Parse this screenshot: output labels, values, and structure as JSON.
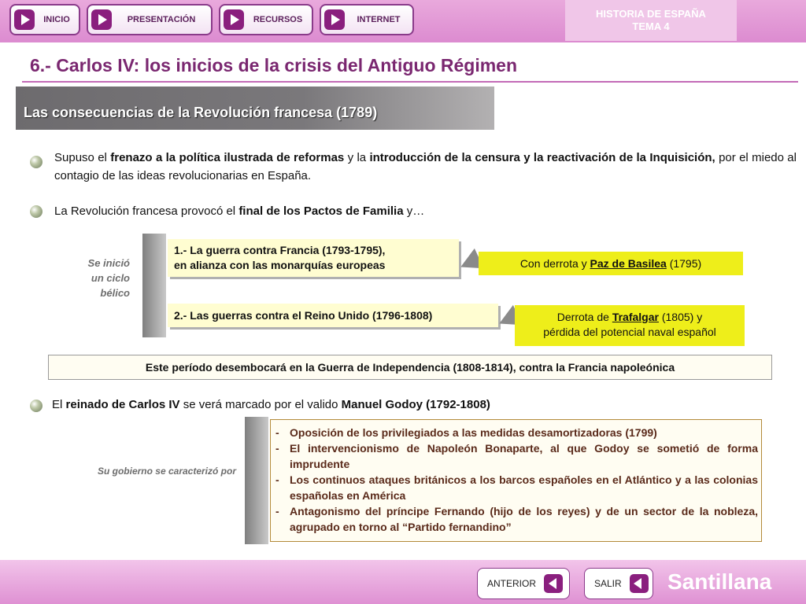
{
  "nav": {
    "inicio": "INICIO",
    "presentacion": "PRESENTACIÓN",
    "recursos": "RECURSOS",
    "internet": "INTERNET"
  },
  "topic": {
    "line1": "HISTORIA DE ESPAÑA",
    "line2": "TEMA 4"
  },
  "page_title": "6.- Carlos IV: los inicios de la crisis del Antiguo Régimen",
  "section_title": "Las consecuencias de la Revolución francesa (1789)",
  "point1": {
    "t1": "Supuso el ",
    "b1": "frenazo a la política ilustrada de reformas",
    "t2": " y la ",
    "b2": "introducción de la censura y la reactivación de la Inquisición,",
    "t3": " por el miedo al contagio de las ideas revolucionarias en España."
  },
  "point2": {
    "t1": "La Revolución francesa provocó el ",
    "b1": "final de los Pactos de Familia",
    "t2": " y…"
  },
  "cycle": {
    "l1": "Se inició",
    "l2": "un ciclo",
    "l3": "bélico"
  },
  "war1": {
    "line1": "1.- La guerra contra Francia (1793-1795),",
    "line2": "en alianza con las monarquías europeas"
  },
  "war1_result": {
    "t1": "Con derrota y ",
    "u1": "Paz de Basilea",
    "t2": " (1795)"
  },
  "war2": {
    "line1": "2.- Las guerras contra el Reino Unido (1796-1808)"
  },
  "war2_result": {
    "t1": "Derrota de ",
    "u1": "Trafalgar",
    "t2": " (1805) y",
    "line2": "pérdida del potencial naval español"
  },
  "period_text": "Este período desembocará en la Guerra de Independencia (1808-1814), contra la Francia napoleónica",
  "point3": {
    "t1": "El ",
    "b1": "reinado de Carlos IV",
    "t2": " se verá marcado por el valido ",
    "b2": "Manuel Godoy (1792-1808)"
  },
  "gov_label": "Su gobierno se caracterizó por",
  "gov_items": {
    "i0": "Oposición de los privilegiados a las medidas desamortizadoras (1799)",
    "i1": "El intervencionismo de Napoleón Bonaparte, al que Godoy se sometió de forma imprudente",
    "i2": "Los continuos ataques británicos a los barcos españoles en el Atlántico y a las colonias españolas en América",
    "i3": "Antagonismo del príncipe Fernando (hijo de los reyes) y de un sector de la nobleza, agrupado en torno al “Partido fernandino”"
  },
  "dash": "-",
  "footer": {
    "anterior": "ANTERIOR",
    "salir": "SALIR",
    "brand": "Santillana"
  },
  "colors": {
    "accent": "#8a1f7e",
    "title": "#7a2770",
    "highlight": "#eeee1a"
  }
}
